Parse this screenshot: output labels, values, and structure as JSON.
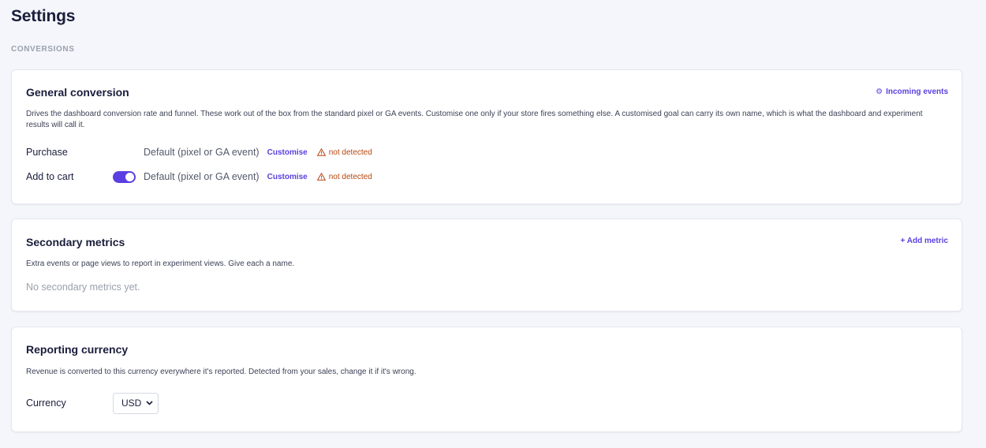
{
  "page": {
    "title": "Settings",
    "section_label": "CONVERSIONS"
  },
  "colors": {
    "accent": "#5b3fe0",
    "warning": "#b8450d",
    "background": "#f4f6fb"
  },
  "general_conversion": {
    "title": "General conversion",
    "action_label": "Incoming events",
    "action_icon": "gear-icon",
    "description": "Drives the dashboard conversion rate and funnel. These work out of the box from the standard pixel or GA events. Customise one only if your store fires something else. A customised goal can carry its own name, which is what the dashboard and experiment results will call it.",
    "rows": [
      {
        "label": "Purchase",
        "toggle": false,
        "default_text": "Default (pixel or GA event)",
        "customise_label": "Customise",
        "status": "not detected"
      },
      {
        "label": "Add to cart",
        "toggle": true,
        "default_text": "Default (pixel or GA event)",
        "customise_label": "Customise",
        "status": "not detected"
      }
    ]
  },
  "secondary_metrics": {
    "title": "Secondary metrics",
    "action_label": "+ Add metric",
    "description": "Extra events or page views to report in experiment views. Give each a name.",
    "empty_text": "No secondary metrics yet."
  },
  "reporting_currency": {
    "title": "Reporting currency",
    "description": "Revenue is converted to this currency everywhere it's reported. Detected from your sales, change it if it's wrong.",
    "field_label": "Currency",
    "selected": "USD"
  }
}
